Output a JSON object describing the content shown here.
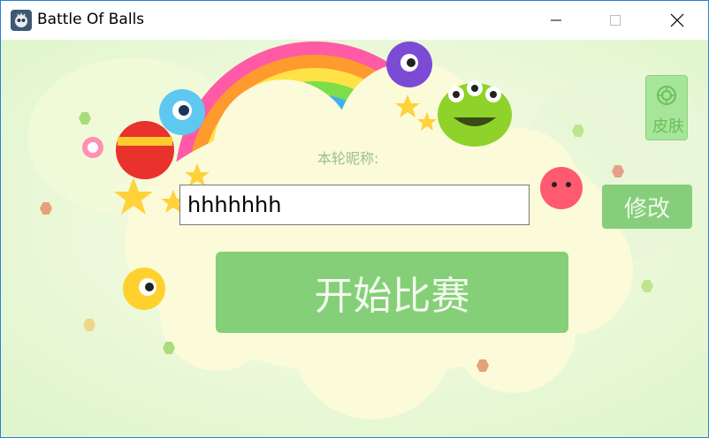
{
  "window": {
    "title": "Battle Of Balls",
    "controls": {
      "minimize": "minimize",
      "maximize": "maximize",
      "close": "close"
    }
  },
  "form": {
    "nickname_label": "本轮昵称:",
    "nickname_value": "hhhhhhh",
    "start_button": "开始比赛",
    "modify_button": "修改",
    "skin_button": "皮肤"
  },
  "colors": {
    "accent_green": "#85cf78",
    "window_border": "#2b7fd6",
    "background": "#eaf8d6"
  },
  "icons": {
    "app": "app-logo-icon",
    "skin": "skin-ring-icon"
  }
}
